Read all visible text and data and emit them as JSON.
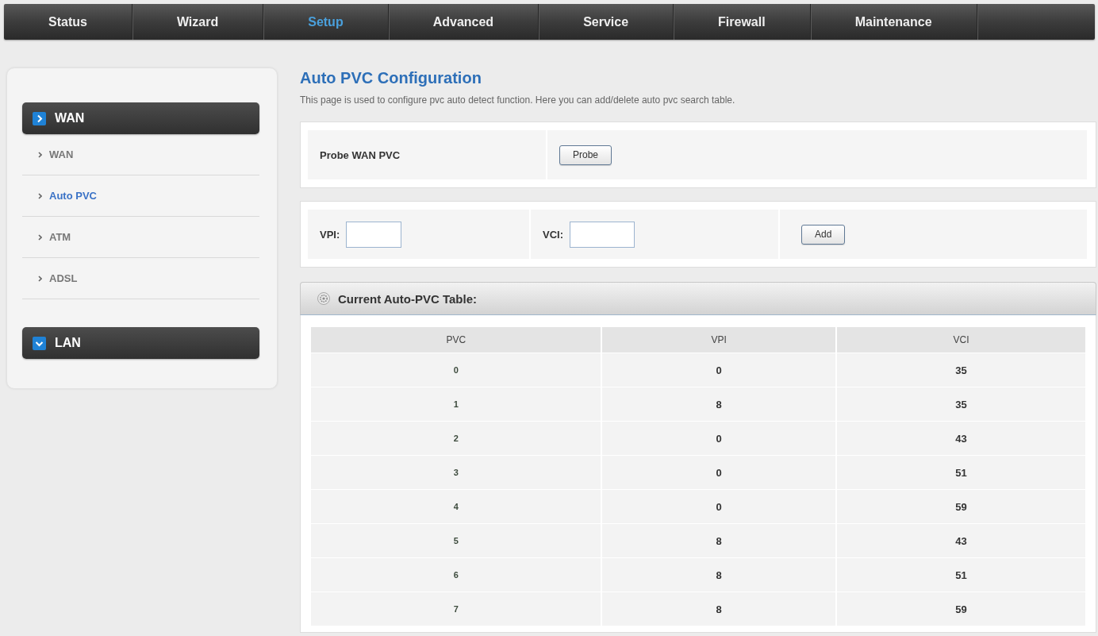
{
  "nav": {
    "tabs": [
      {
        "label": "Status",
        "selected": false
      },
      {
        "label": "Wizard",
        "selected": false
      },
      {
        "label": "Setup",
        "selected": true
      },
      {
        "label": "Advanced",
        "selected": false
      },
      {
        "label": "Service",
        "selected": false
      },
      {
        "label": "Firewall",
        "selected": false
      },
      {
        "label": "Maintenance",
        "selected": false
      }
    ]
  },
  "sidebar": {
    "groups": [
      {
        "title": "WAN",
        "expanded": true,
        "items": [
          {
            "label": "WAN",
            "selected": false
          },
          {
            "label": "Auto PVC",
            "selected": true
          },
          {
            "label": "ATM",
            "selected": false
          },
          {
            "label": "ADSL",
            "selected": false
          }
        ]
      },
      {
        "title": "LAN",
        "expanded": false
      }
    ]
  },
  "content": {
    "title": "Auto PVC Configuration",
    "description": "This page is used to configure pvc auto detect function. Here you can add/delete auto pvc search table.",
    "probe": {
      "label": "Probe WAN PVC",
      "button": "Probe"
    },
    "add_form": {
      "vpi_label": "VPI:",
      "vci_label": "VCI:",
      "button": "Add"
    },
    "table": {
      "title": "Current Auto-PVC Table:",
      "columns": [
        "PVC",
        "VPI",
        "VCI"
      ],
      "rows": [
        [
          "0",
          "0",
          "35"
        ],
        [
          "1",
          "8",
          "35"
        ],
        [
          "2",
          "0",
          "43"
        ],
        [
          "3",
          "0",
          "51"
        ],
        [
          "4",
          "0",
          "59"
        ],
        [
          "5",
          "8",
          "43"
        ],
        [
          "6",
          "8",
          "51"
        ],
        [
          "7",
          "8",
          "59"
        ]
      ]
    }
  }
}
